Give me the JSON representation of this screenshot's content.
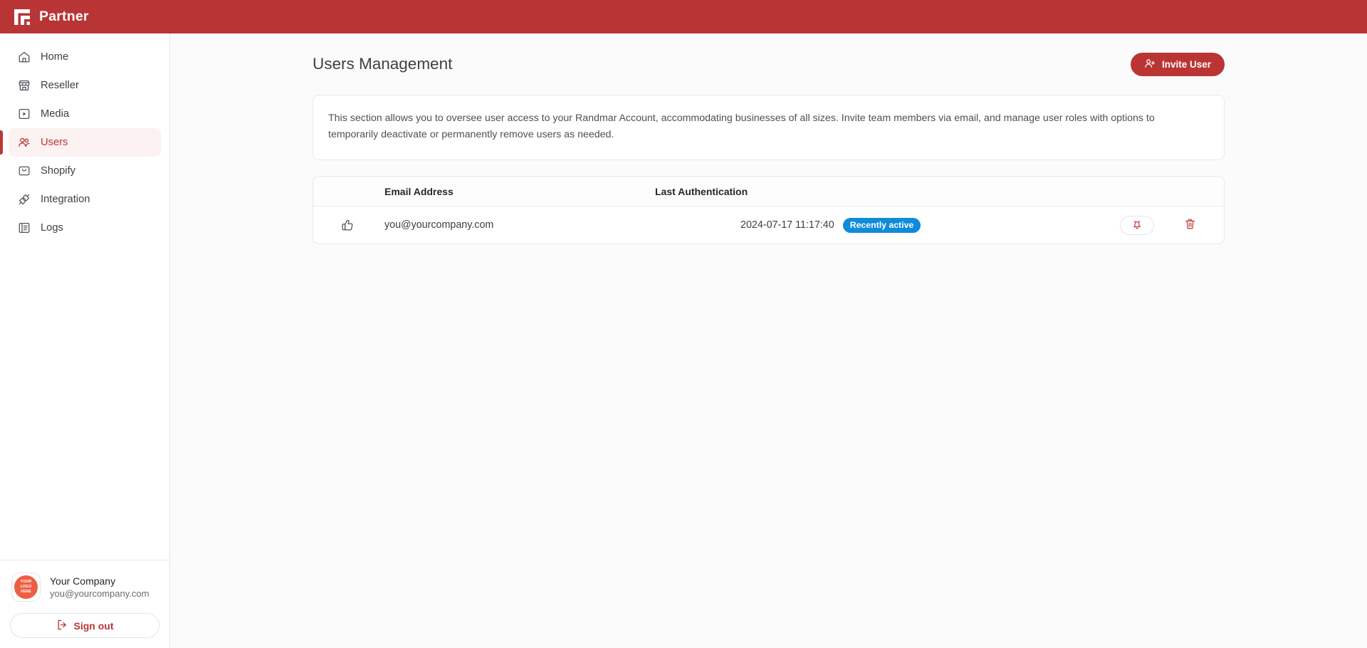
{
  "brand": {
    "name": "Partner",
    "logo_icon": "partner-frame-logo",
    "header_color": "#b93434"
  },
  "sidebar": {
    "items": [
      {
        "label": "Home",
        "icon": "home-icon",
        "active": false
      },
      {
        "label": "Reseller",
        "icon": "store-icon",
        "active": false
      },
      {
        "label": "Media",
        "icon": "play-square-icon",
        "active": false
      },
      {
        "label": "Users",
        "icon": "users-icon",
        "active": true
      },
      {
        "label": "Shopify",
        "icon": "shopping-bag-icon",
        "active": false
      },
      {
        "label": "Integration",
        "icon": "plug-icon",
        "active": false
      },
      {
        "label": "Logs",
        "icon": "book-list-icon",
        "active": false
      }
    ],
    "account": {
      "avatar_text_lines": [
        "YOUR",
        "LOGO",
        "HERE"
      ],
      "avatar_icon": "company-avatar",
      "name": "Your Company",
      "email": "you@yourcompany.com"
    },
    "signout": {
      "label": "Sign out",
      "icon": "logout-icon"
    }
  },
  "main": {
    "title": "Users Management",
    "invite_button": {
      "label": "Invite User",
      "icon": "user-plus-icon"
    },
    "info_text": "This section allows you to oversee user access to your Randmar Account, accommodating businesses of all sizes. Invite team members via email, and manage user roles with options to temporarily deactivate or permanently remove users as needed.",
    "table": {
      "columns": [
        "",
        "Email Address",
        "Last Authentication",
        ""
      ],
      "rows": [
        {
          "flag_icon": "thumbs-up-icon",
          "email": "you@yourcompany.com",
          "last_authentication": "2024-07-17 11:17:40",
          "status_badge": "Recently active",
          "status_color": "#0e8bd9",
          "actions": [
            {
              "name": "notify-button",
              "icon": "alarm-bell-icon"
            },
            {
              "name": "delete-button",
              "icon": "trash-icon"
            }
          ]
        }
      ]
    }
  }
}
